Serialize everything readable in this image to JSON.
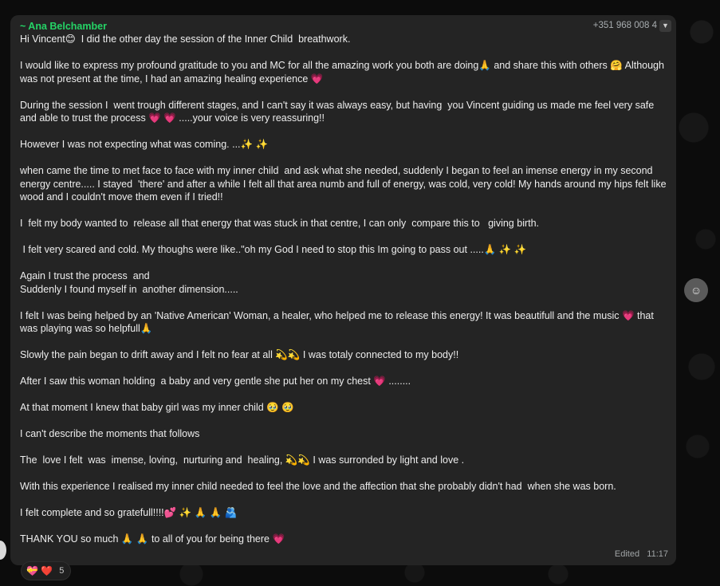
{
  "message": {
    "sender": "~ Ana Belchamber",
    "phone": "+351 968 008 4",
    "text": "Hi Vincent😊  I did the other day the session of the Inner Child  breathwork.\n\nI would like to express my profound gratitude to you and MC for all the amazing work you both are doing🙏 and share this with others 🤗 Although was not present at the time, I had an amazing healing experience 💗\n\nDuring the session I  went trough different stages, and I can't say it was always easy, but having  you Vincent guiding us made me feel very safe and able to trust the process 💗 💗 .....your voice is very reassuring!!\n\nHowever I was not expecting what was coming. ...✨ ✨\n\nwhen came the time to met face to face with my inner child  and ask what she needed, suddenly I began to feel an imense energy in my second energy centre..... I stayed  'there' and after a while I felt all that area numb and full of energy, was cold, very cold! My hands around my hips felt like wood and I couldn't move them even if I tried!!\n\nI  felt my body wanted to  release all that energy that was stuck in that centre, I can only  compare this to   giving birth.\n\n I felt very scared and cold. My thoughs were like..\"oh my God I need to stop this Im going to pass out .....🙏 ✨ ✨\n\nAgain I trust the process  and\nSuddenly I found myself in  another dimension.....\n\nI felt I was being helped by an 'Native American' Woman, a healer, who helped me to release this energy! It was beautifull and the music 💗 that was playing was so helpfull🙏\n\nSlowly the pain began to drift away and I felt no fear at all 💫💫 I was totaly connected to my body!!\n\nAfter I saw this woman holding  a baby and very gentle she put her on my chest 💗 ........\n\nAt that moment I knew that baby girl was my inner child 🥹 🥹\n\nI can't describe the moments that follows\n\nThe  love I felt  was  imense, loving,  nurturing and  healing, 💫💫 I was surronded by light and love .\n\nWith this experience I realised my inner child needed to feel the love and the affection that she probably didn't had  when she was born.\n\nI felt complete and so gratefull!!!!💕 ✨ 🙏 🙏 🫂\n\nTHANK YOU so much 🙏 🙏 to all of you for being there 💗",
    "status": "Edited",
    "time": "11:17"
  },
  "reactions": {
    "emojis": "💝 ❤️",
    "count": "5"
  },
  "icons": {
    "menu": "chevron-down-icon",
    "emoji_button": "smiley-icon"
  },
  "colors": {
    "sender": "#25d366",
    "bubble": "#242424",
    "background": "#0c0c0c"
  }
}
